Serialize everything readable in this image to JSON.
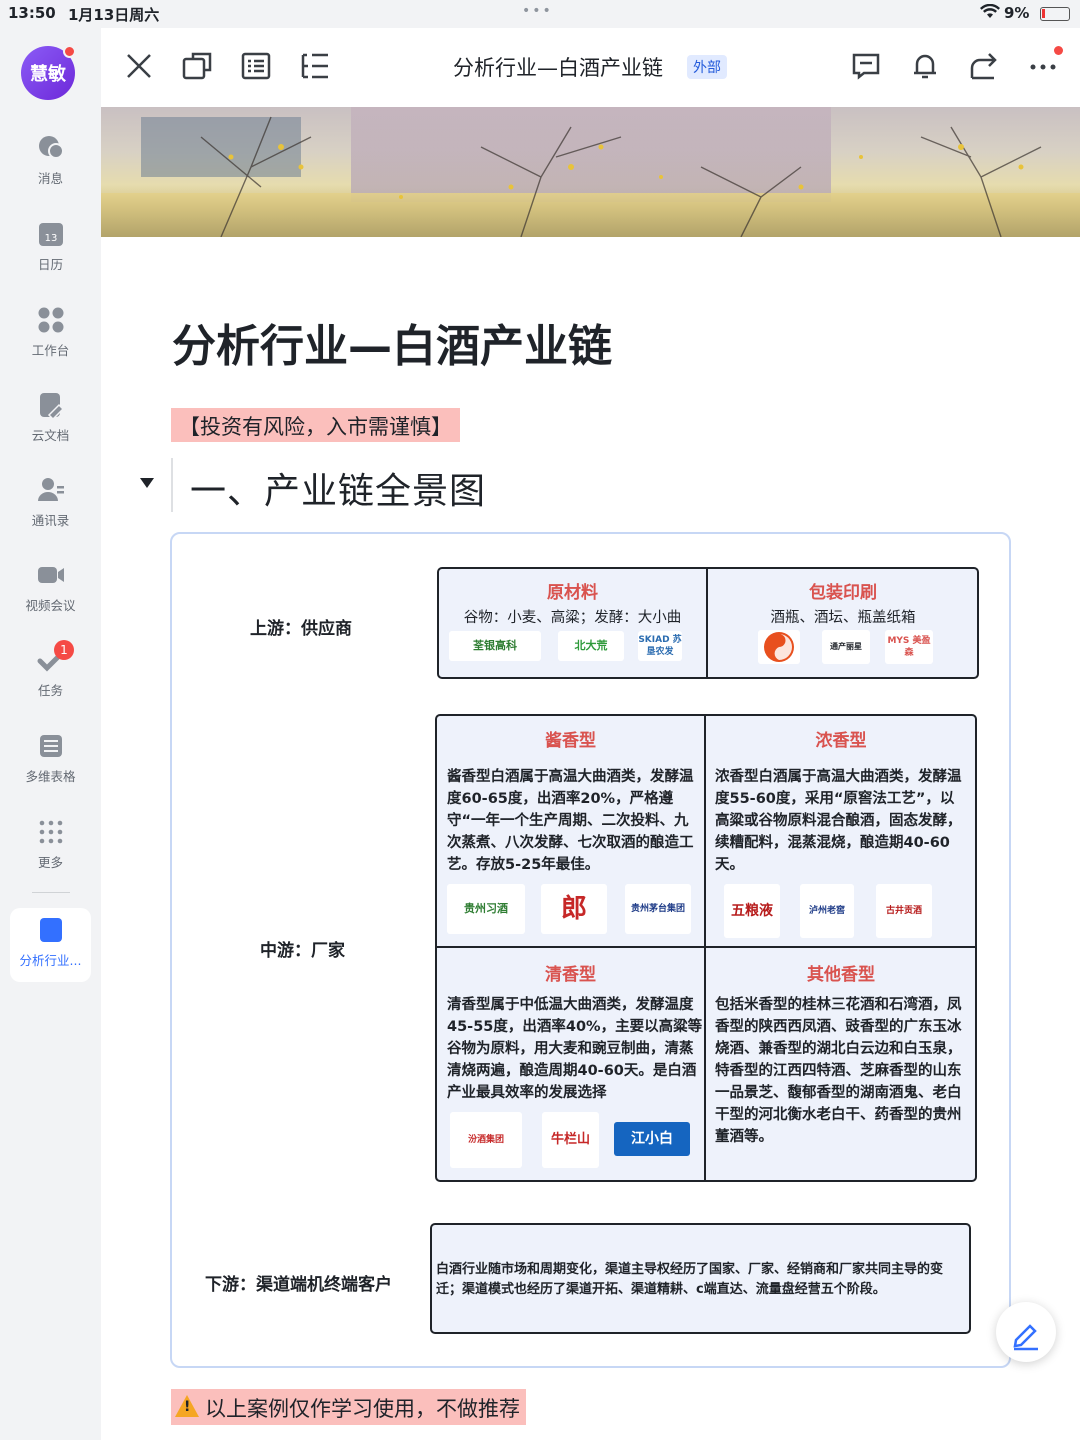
{
  "status_bar": {
    "time": "13:50",
    "date": "1月13日周六",
    "battery": "9%"
  },
  "rail": {
    "avatar_text": "慧敏",
    "items": [
      {
        "label": "消息",
        "icon": "chat-icon"
      },
      {
        "label": "日历",
        "icon": "calendar-icon",
        "icon_text": "13"
      },
      {
        "label": "工作台",
        "icon": "grid-icon"
      },
      {
        "label": "云文档",
        "icon": "document-icon"
      },
      {
        "label": "通讯录",
        "icon": "contacts-icon"
      },
      {
        "label": "视频会议",
        "icon": "video-icon"
      },
      {
        "label": "任务",
        "icon": "task-icon",
        "badge": "1"
      },
      {
        "label": "多维表格",
        "icon": "table-icon"
      },
      {
        "label": "更多",
        "icon": "more-dots-icon"
      }
    ],
    "active_item": "分析行业..."
  },
  "toolbar": {
    "title": "分析行业—白酒产业链",
    "tag": "外部"
  },
  "doc": {
    "h1": "分析行业—白酒产业链",
    "risk": "【投资有风险，入市需谨慎】",
    "h2": "一、产业链全景图",
    "upstream": {
      "label": "上游：供应商",
      "cells": [
        {
          "title": "原材料",
          "sub": "谷物：小麦、高粱；发酵：大小曲",
          "logos": [
            "荃银高科",
            "北大荒",
            "SKIAD 苏垦农发"
          ]
        },
        {
          "title": "包装印刷",
          "sub": "酒瓶、酒坛、瓶盖纸箱",
          "logos": [
            "",
            "通产丽星",
            "MYS 美盈森"
          ]
        }
      ]
    },
    "midstream": {
      "label": "中游：厂家",
      "cells": [
        {
          "title": "酱香型",
          "text": "酱香型白酒属于高温大曲酒类，发酵温度60-65度，出酒率20%，严格遵守“一年一个生产周期、二次投料、九次蒸煮、八次发酵、七次取酒的酿造工艺。存放5-25年最佳。",
          "logos": [
            "贵州习酒",
            "郎",
            "贵州茅台集团"
          ]
        },
        {
          "title": "浓香型",
          "text": "浓香型白酒属于高温大曲酒类，发酵温度55-60度，采用“原窖法工艺”，以高粱或谷物原料混合酿酒，固态发酵，续糟配料，混蒸混烧，酿造期40-60天。",
          "logos": [
            "五粮液",
            "泸州老窖",
            "古井贡酒"
          ]
        },
        {
          "title": "清香型",
          "text": "清香型属于中低温大曲酒类，发酵温度45-55度，出酒率40%，主要以高粱等谷物为原料，用大麦和豌豆制曲，清蒸清烧两遍，酿造周期40-60天。是白酒产业最具效率的发展选择",
          "logos": [
            "汾酒集团",
            "牛栏山",
            "江小白"
          ]
        },
        {
          "title": "其他香型",
          "text": "包括米香型的桂林三花酒和石湾酒，凤香型的陕西西凤酒、豉香型的广东玉冰烧酒、兼香型的湖北白云边和白玉泉，特香型的江西四特酒、芝麻香型的山东一品景芝、馥郁香型的湖南酒鬼、老白干型的河北衡水老白干、药香型的贵州董酒等。",
          "logos": []
        }
      ]
    },
    "downstream": {
      "label": "下游：渠道端机终端客户",
      "text": "白酒行业随市场和周期变化，渠道主导权经历了国家、厂家、经销商和厂家共同主导的变迁；渠道模式也经历了渠道开拓、渠道精耕、c端直达、流量盘经营五个阶段。"
    },
    "disclaimer": "以上案例仅作学习使用，不做推荐"
  },
  "colors": {
    "accent": "#3370ff",
    "highlight": "#fbbfbc",
    "cell_title": "#d9534f",
    "cell_bg": "#eef2fb"
  }
}
